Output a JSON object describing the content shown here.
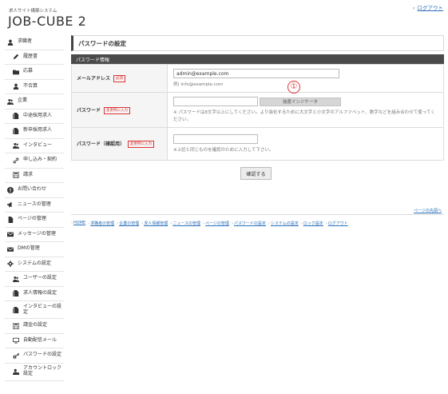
{
  "header": {
    "subtitle": "求人サイト構築システム",
    "title": "JOB-CUBE 2",
    "logout": "ログアウト"
  },
  "sidebar": {
    "items": [
      {
        "label": "求職者",
        "icon": "user-icon",
        "level": "top"
      },
      {
        "label": "履歴書",
        "icon": "pencil-icon",
        "level": "sub"
      },
      {
        "label": "応募",
        "icon": "folder-icon",
        "level": "sub"
      },
      {
        "label": "不合算",
        "icon": "user-icon",
        "level": "sub"
      },
      {
        "label": "企業",
        "icon": "users-icon",
        "level": "top"
      },
      {
        "label": "中途採用求人",
        "icon": "document-icon",
        "level": "sub"
      },
      {
        "label": "新卒採用求人",
        "icon": "document-icon",
        "level": "sub"
      },
      {
        "label": "インタビュー",
        "icon": "users-icon",
        "level": "sub"
      },
      {
        "label": "申し込み・契約",
        "icon": "link-icon",
        "level": "sub"
      },
      {
        "label": "請求",
        "icon": "calculator-icon",
        "level": "sub"
      },
      {
        "label": "お問い合わせ",
        "icon": "info-icon",
        "level": "top"
      },
      {
        "label": "ニュースの管理",
        "icon": "megaphone-icon",
        "level": "top"
      },
      {
        "label": "ページの管理",
        "icon": "page-icon",
        "level": "top"
      },
      {
        "label": "メッセージの管理",
        "icon": "inbox-icon",
        "level": "top"
      },
      {
        "label": "DMの管理",
        "icon": "mail-icon",
        "level": "top"
      },
      {
        "label": "システムの設定",
        "icon": "gear-icon",
        "level": "top"
      },
      {
        "label": "ユーザーの設定",
        "icon": "users-icon",
        "level": "sub"
      },
      {
        "label": "求人情報の設定",
        "icon": "document-icon",
        "level": "sub"
      },
      {
        "label": "インタビューの設定",
        "icon": "document-icon",
        "level": "sub"
      },
      {
        "label": "請金の設定",
        "icon": "calculator-icon",
        "level": "sub"
      },
      {
        "label": "自動配信メール",
        "icon": "monitor-icon",
        "level": "sub"
      },
      {
        "label": "パスワードの設定",
        "icon": "key-icon",
        "level": "sub"
      },
      {
        "label": "アカウントロック設定",
        "icon": "user-lock-icon",
        "level": "sub"
      }
    ]
  },
  "main": {
    "page_title": "パスワードの設定",
    "section_title": "パスワード情報",
    "rows": {
      "email": {
        "label": "メールアドレス",
        "badge": "必須",
        "value": "admin@example.com",
        "hint": "例) info@example.com"
      },
      "password": {
        "label": "パスワード",
        "badge": "変更時に入力",
        "value": "",
        "strength": "強度インジケータ",
        "hint": "※ パスワードは8文字以上にしてください。より強化するために大文字と小文字のアルファベット、数字などを組み合わせて使ってください。"
      },
      "confirm": {
        "label": "パスワード（確認用）",
        "badge": "変更時に入力",
        "value": "",
        "hint": "※上記と同じものを確認のために入力して下さい。"
      }
    },
    "marker": "①",
    "submit_label": "確認する"
  },
  "footer": {
    "page_top": "ページの先頭へ",
    "breadcrumb": [
      "HOME",
      "求職者の管理",
      "企業の管理",
      "求人情報管理",
      "ニュースの管理",
      "ページの管理",
      "パスワードの設定",
      "システムの設定",
      "ロック設定",
      "ログアウト"
    ]
  },
  "colors": {
    "accent_link": "#2a6fb8",
    "required_red": "#dd3333",
    "section_header": "#4a4a4a"
  }
}
